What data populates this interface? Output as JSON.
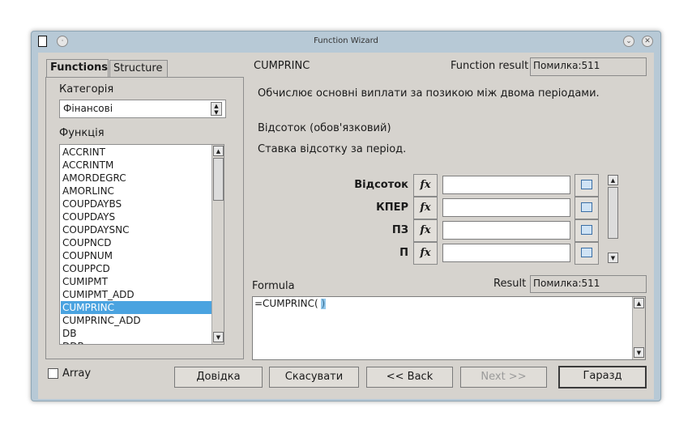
{
  "window": {
    "title": "Function Wizard"
  },
  "tabs": {
    "functions": "Functions",
    "structure": "Structure"
  },
  "left": {
    "category_label": "Категорія",
    "category_value": "Фінансові",
    "function_label": "Функція",
    "functions": [
      "ACCRINT",
      "ACCRINTM",
      "AMORDEGRC",
      "AMORLINC",
      "COUPDAYBS",
      "COUPDAYS",
      "COUPDAYSNC",
      "COUPNCD",
      "COUPNUM",
      "COUPPCD",
      "CUMIPMT",
      "CUMIPMT_ADD",
      "CUMPRINC",
      "CUMPRINC_ADD",
      "DB",
      "DDB"
    ],
    "selected_function": "CUMPRINC"
  },
  "right": {
    "function_name": "CUMPRINC",
    "function_result_label": "Function result",
    "function_result_value": "Помилка:511",
    "description": "Обчислює основні виплати за позикою між двома періодами.",
    "arg_title": "Відсоток (обов'язковий)",
    "arg_description": "Ставка відсотку за період.",
    "args": [
      "Відсоток",
      "КПЕР",
      "ПЗ",
      "П"
    ],
    "fx_label": "fx",
    "formula_label": "Formula",
    "result_label": "Result",
    "result_value": "Помилка:511",
    "formula_text": "=CUMPRINC( )"
  },
  "footer": {
    "array_label": "Array",
    "help": "Довідка",
    "cancel": "Скасувати",
    "back": "<< Back",
    "next": "Next >>",
    "ok": "Гаразд"
  },
  "colors": {
    "selection": "#4aa3e0",
    "dialog_bg": "#d6d3ce",
    "frame": "#b7c9d6"
  }
}
